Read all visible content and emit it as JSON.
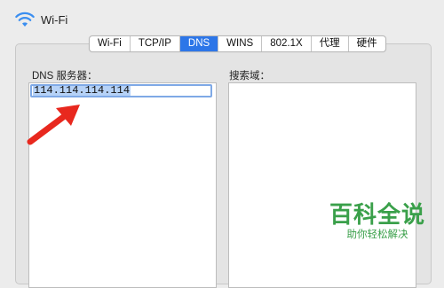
{
  "window": {
    "title": "Wi-Fi",
    "icon": "wifi-icon"
  },
  "tabs": [
    {
      "label": "Wi-Fi",
      "active": false
    },
    {
      "label": "TCP/IP",
      "active": false
    },
    {
      "label": "DNS",
      "active": true
    },
    {
      "label": "WINS",
      "active": false
    },
    {
      "label": "802.1X",
      "active": false
    },
    {
      "label": "代理",
      "active": false
    },
    {
      "label": "硬件",
      "active": false
    }
  ],
  "dns": {
    "label": "DNS 服务器：",
    "entries": [
      "114.114.114.114"
    ]
  },
  "search_domains": {
    "label": "搜索域：",
    "entries": []
  },
  "annotation": {
    "icon": "red-arrow-icon",
    "color": "#e8281e"
  },
  "watermark": {
    "main": "百科全说",
    "sub": "助你轻松解决",
    "color": "#3aa04a"
  }
}
